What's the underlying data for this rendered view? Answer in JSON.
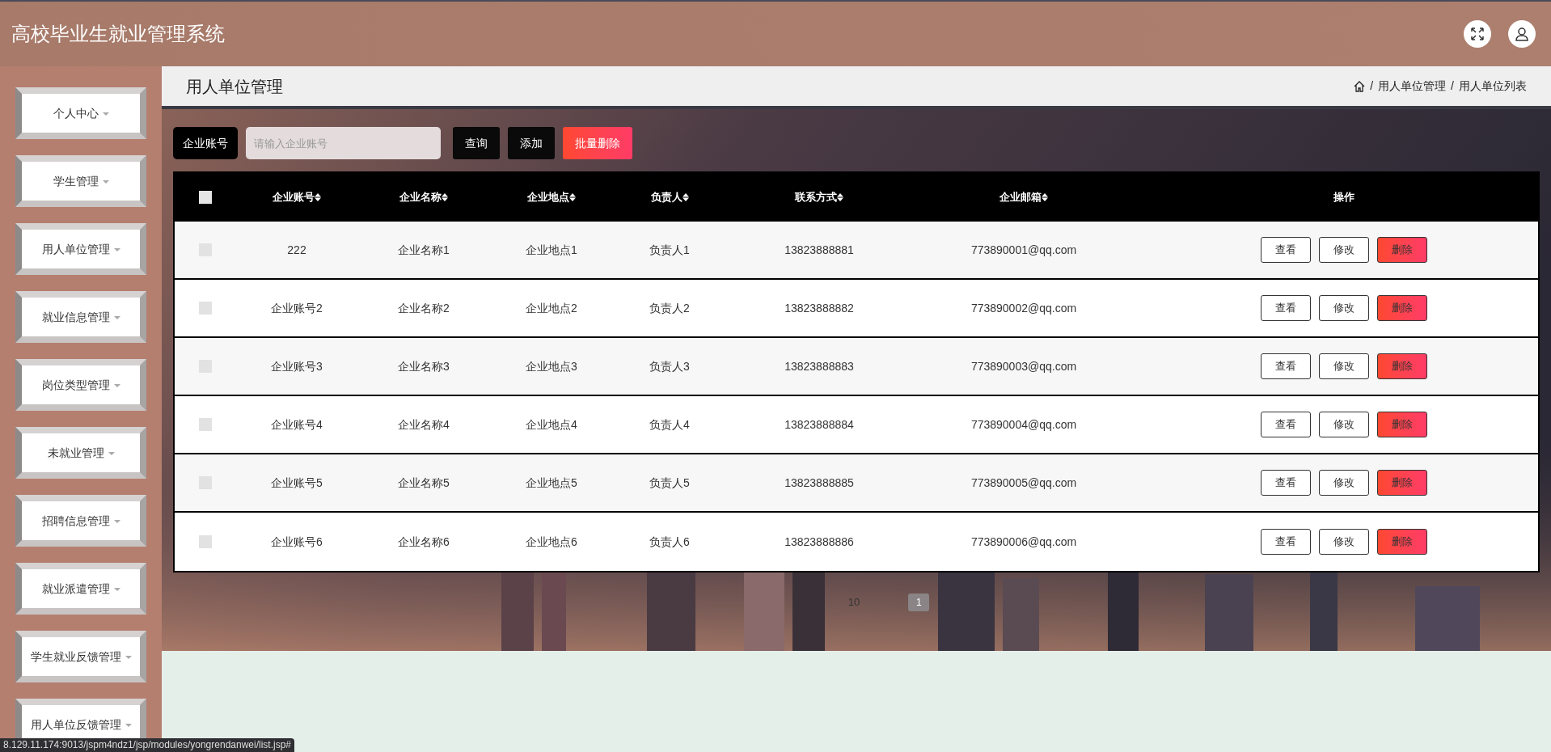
{
  "header": {
    "title": "高校毕业生就业管理系统"
  },
  "sidebar": {
    "items": [
      {
        "label": "个人中心"
      },
      {
        "label": "学生管理"
      },
      {
        "label": "用人单位管理"
      },
      {
        "label": "就业信息管理"
      },
      {
        "label": "岗位类型管理"
      },
      {
        "label": "未就业管理"
      },
      {
        "label": "招聘信息管理"
      },
      {
        "label": "就业派遣管理"
      },
      {
        "label": "学生就业反馈管理"
      },
      {
        "label": "用人单位反馈管理"
      }
    ]
  },
  "page": {
    "title": "用人单位管理",
    "separator": "/",
    "breadcrumb": [
      "用人单位管理",
      "用人单位列表"
    ]
  },
  "search": {
    "label": "企业账号",
    "placeholder": "请输入企业账号",
    "buttons": [
      {
        "label": "查询",
        "kind": "dark"
      },
      {
        "label": "添加",
        "kind": "dark"
      },
      {
        "label": "批量删除",
        "kind": "danger"
      }
    ]
  },
  "table": {
    "select_all": {
      "checked": false
    },
    "columns": [
      {
        "label": "企业账号",
        "sortable": true
      },
      {
        "label": "企业名称",
        "sortable": true
      },
      {
        "label": "企业地点",
        "sortable": true
      },
      {
        "label": "负责人",
        "sortable": true
      },
      {
        "label": "联系方式",
        "sortable": true
      },
      {
        "label": "企业邮箱",
        "sortable": true
      },
      {
        "label": "操作",
        "sortable": false
      }
    ],
    "rows": [
      {
        "checked": false,
        "cells": [
          "222",
          "企业名称1",
          "企业地点1",
          "负责人1",
          "13823888881",
          "773890001@qq.com"
        ],
        "actions": [
          {
            "label": "查看",
            "kind": "plain"
          },
          {
            "label": "修改",
            "kind": "plain"
          },
          {
            "label": "删除",
            "kind": "danger"
          }
        ]
      },
      {
        "checked": false,
        "cells": [
          "企业账号2",
          "企业名称2",
          "企业地点2",
          "负责人2",
          "13823888882",
          "773890002@qq.com"
        ],
        "actions": [
          {
            "label": "查看",
            "kind": "plain"
          },
          {
            "label": "修改",
            "kind": "plain"
          },
          {
            "label": "删除",
            "kind": "danger"
          }
        ]
      },
      {
        "checked": false,
        "cells": [
          "企业账号3",
          "企业名称3",
          "企业地点3",
          "负责人3",
          "13823888883",
          "773890003@qq.com"
        ],
        "actions": [
          {
            "label": "查看",
            "kind": "plain"
          },
          {
            "label": "修改",
            "kind": "plain"
          },
          {
            "label": "删除",
            "kind": "danger"
          }
        ]
      },
      {
        "checked": false,
        "cells": [
          "企业账号4",
          "企业名称4",
          "企业地点4",
          "负责人4",
          "13823888884",
          "773890004@qq.com"
        ],
        "actions": [
          {
            "label": "查看",
            "kind": "plain"
          },
          {
            "label": "修改",
            "kind": "plain"
          },
          {
            "label": "删除",
            "kind": "danger"
          }
        ]
      },
      {
        "checked": false,
        "cells": [
          "企业账号5",
          "企业名称5",
          "企业地点5",
          "负责人5",
          "13823888885",
          "773890005@qq.com"
        ],
        "actions": [
          {
            "label": "查看",
            "kind": "plain"
          },
          {
            "label": "修改",
            "kind": "plain"
          },
          {
            "label": "删除",
            "kind": "danger"
          }
        ]
      },
      {
        "checked": false,
        "cells": [
          "企业账号6",
          "企业名称6",
          "企业地点6",
          "负责人6",
          "13823888886",
          "773890006@qq.com"
        ],
        "actions": [
          {
            "label": "查看",
            "kind": "plain"
          },
          {
            "label": "修改",
            "kind": "plain"
          },
          {
            "label": "删除",
            "kind": "danger"
          }
        ]
      }
    ]
  },
  "pagination": {
    "page_size": "10",
    "pages": [
      {
        "label": "1",
        "selected": true
      }
    ]
  },
  "status_bar": {
    "url": "8.129.11.174:9013/jspm4ndz1/jsp/modules/yongrendanwei/list.jsp#"
  }
}
